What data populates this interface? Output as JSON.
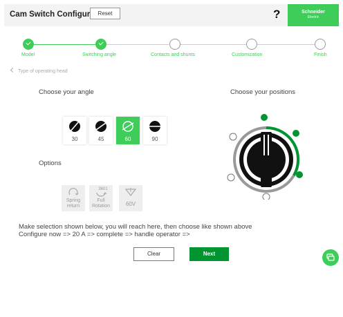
{
  "header": {
    "title": "Cam Switch Configurator",
    "reset_label": "Reset",
    "help_label": "?",
    "brand_name": "Schneider",
    "brand_sub": "Electric"
  },
  "stepper": {
    "steps": [
      {
        "label": "Model",
        "state": "done"
      },
      {
        "label": "Switching angle",
        "state": "done"
      },
      {
        "label": "Contacts and shunts",
        "state": "pending"
      },
      {
        "label": "Customization",
        "state": "pending"
      },
      {
        "label": "Finish",
        "state": "pending"
      }
    ]
  },
  "back": {
    "label": "Type of operating head"
  },
  "angle_section": {
    "title": "Choose your angle",
    "options": [
      {
        "label": "30",
        "selected": false
      },
      {
        "label": "45",
        "selected": false
      },
      {
        "label": "60",
        "selected": true
      },
      {
        "label": "90",
        "selected": false
      }
    ]
  },
  "positions_section": {
    "title": "Choose your positions"
  },
  "options_section": {
    "title": "Options",
    "items": [
      {
        "line1": "Spring",
        "line2": "return"
      },
      {
        "line1": "Full",
        "line2": "Rotation",
        "badge": "3601"
      },
      {
        "line1": "60V",
        "line2": ""
      }
    ]
  },
  "instructions": {
    "line1": "Make selection shown below, you will reach here, then choose like shown above",
    "line2": "Configure now => 20 A => complete => handle operator =>"
  },
  "actions": {
    "clear_label": "Clear",
    "next_label": "Next"
  },
  "colors": {
    "accent": "#3dcd58",
    "primary": "#009530"
  }
}
